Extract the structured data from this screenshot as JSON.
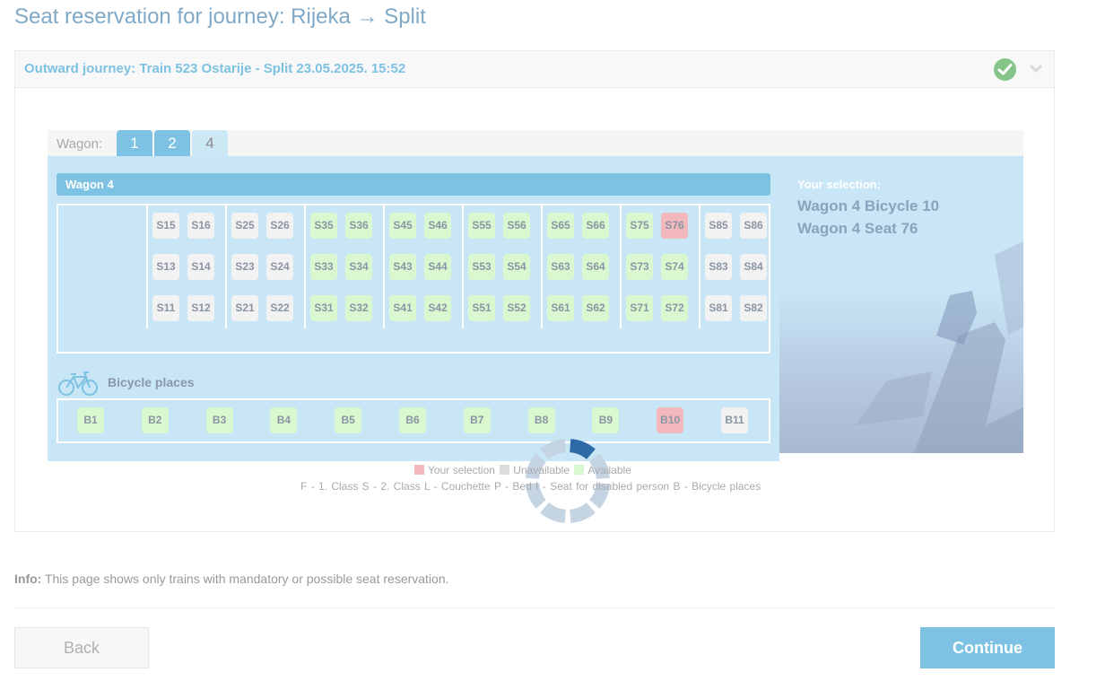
{
  "page": {
    "title": "Seat reservation for journey: Rijeka → Split"
  },
  "journey": {
    "header": "Outward journey: Train 523 Ostarije - Split 23.05.2025. 15:52"
  },
  "tabs": {
    "label": "Wagon:",
    "items": [
      "1",
      "2",
      "4"
    ],
    "active": "4"
  },
  "wagon": {
    "title": "Wagon 4"
  },
  "selection": {
    "label": "Your selection:",
    "items": [
      "Wagon 4 Bicycle 10",
      "Wagon 4 Seat 76"
    ]
  },
  "seats": {
    "rows": [
      [
        "S15",
        "S16",
        "S25",
        "S26",
        "S35",
        "S36",
        "S45",
        "S46",
        "S55",
        "S56",
        "S65",
        "S66",
        "S75",
        "S76",
        "S85",
        "S86"
      ],
      [
        "S13",
        "S14",
        "S23",
        "S24",
        "S33",
        "S34",
        "S43",
        "S44",
        "S53",
        "S54",
        "S63",
        "S64",
        "S73",
        "S74",
        "S83",
        "S84"
      ],
      [
        "S11",
        "S12",
        "S21",
        "S22",
        "S31",
        "S32",
        "S41",
        "S42",
        "S51",
        "S52",
        "S61",
        "S62",
        "S71",
        "S72",
        "S81",
        "S82"
      ]
    ],
    "status": [
      [
        "unavailable",
        "unavailable",
        "unavailable",
        "unavailable",
        "available",
        "available",
        "available",
        "available",
        "available",
        "available",
        "available",
        "available",
        "available",
        "selected",
        "unavailable",
        "unavailable"
      ],
      [
        "unavailable",
        "unavailable",
        "unavailable",
        "unavailable",
        "available",
        "available",
        "available",
        "available",
        "available",
        "available",
        "available",
        "available",
        "available",
        "available",
        "unavailable",
        "unavailable"
      ],
      [
        "unavailable",
        "unavailable",
        "unavailable",
        "unavailable",
        "available",
        "available",
        "available",
        "available",
        "available",
        "available",
        "available",
        "available",
        "available",
        "available",
        "unavailable",
        "unavailable"
      ]
    ]
  },
  "bicycles": {
    "label": "Bicycle places",
    "items": [
      "B1",
      "B2",
      "B3",
      "B4",
      "B5",
      "B6",
      "B7",
      "B8",
      "B9",
      "B10",
      "B11"
    ],
    "status": [
      "available",
      "available",
      "available",
      "available",
      "available",
      "available",
      "available",
      "available",
      "available",
      "selected",
      "unavailable"
    ]
  },
  "legend": {
    "selection": "Your selection",
    "unavailable": "Unavailable",
    "available": "Available",
    "classes": "F - 1. Class   S - 2. Class   L - Couchette   P - Bed   I - Seat for disabled person   B - Bicycle places"
  },
  "info": {
    "label": "Info:",
    "text": " This page shows only trains with mandatory or possible seat reservation."
  },
  "buttons": {
    "back": "Back",
    "continue": "Continue"
  },
  "colors": {
    "accent": "#7dc2e3",
    "available": "#daf8cf",
    "unavailable": "#f2f2f2",
    "selected": "#f3b8bc"
  },
  "icons": [
    "check-circle-icon",
    "chevron-down-icon",
    "bicycle-icon",
    "loading-spinner-icon"
  ]
}
